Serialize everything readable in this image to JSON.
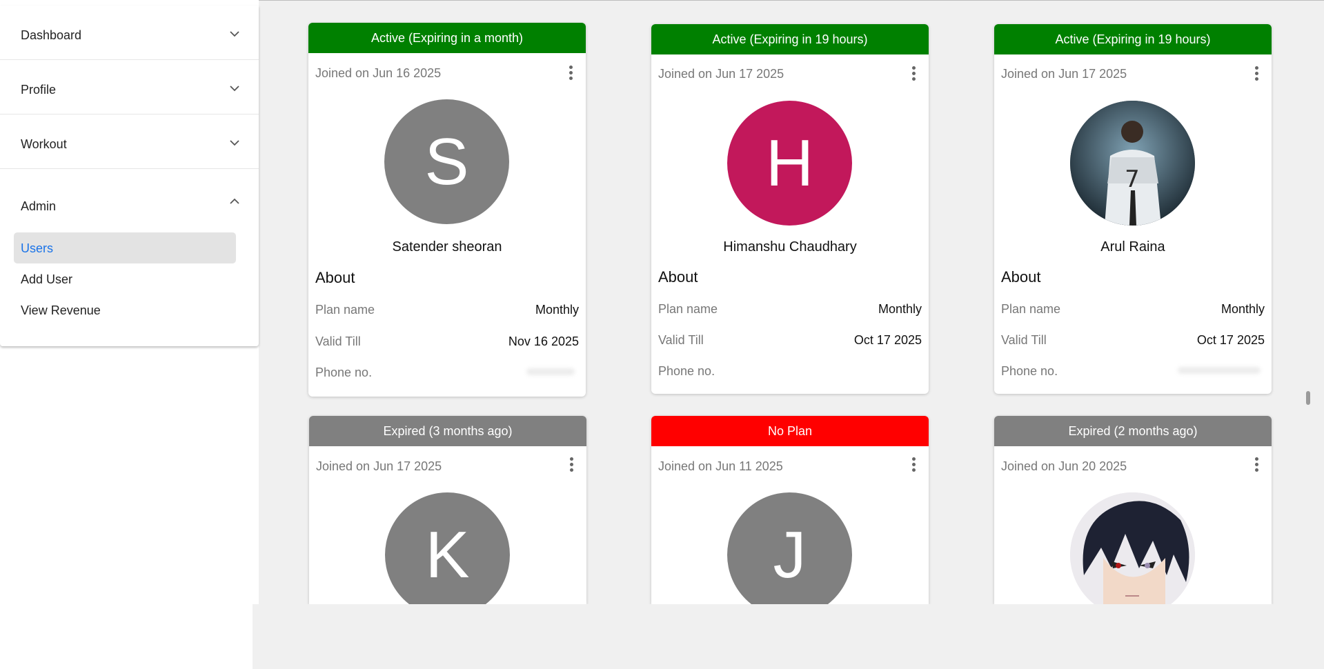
{
  "sidebar": {
    "sections": [
      {
        "label": "Dashboard"
      },
      {
        "label": "Profile"
      },
      {
        "label": "Workout"
      }
    ],
    "admin": {
      "label": "Admin",
      "items": [
        {
          "label": "Users",
          "active": true
        },
        {
          "label": "Add User"
        },
        {
          "label": "View Revenue"
        }
      ]
    }
  },
  "about_label": "About",
  "field_labels": {
    "plan": "Plan name",
    "valid": "Valid Till",
    "phone": "Phone no."
  },
  "colors": {
    "active": "#008000",
    "expired": "#808080",
    "no_plan": "#ff0000",
    "avatar_grey": "#808080",
    "avatar_pink": "#c2185b",
    "link_blue": "#1a73e8"
  },
  "cards": [
    {
      "status": "Active (Expiring in a month)",
      "status_type": "active",
      "joined": "Joined on Jun 16 2025",
      "avatar_letter": "S",
      "avatar_color": "#808080",
      "name": "Satender sheoran",
      "plan": "Monthly",
      "valid_till": "Nov 16 2025"
    },
    {
      "status": "Active (Expiring in 19 hours)",
      "status_type": "active",
      "joined": "Joined on Jun 17 2025",
      "avatar_letter": "H",
      "avatar_color": "#c2185b",
      "name": "Himanshu Chaudhary",
      "plan": "Monthly",
      "valid_till": "Oct 17 2025"
    },
    {
      "status": "Active (Expiring in 19 hours)",
      "status_type": "active",
      "joined": "Joined on Jun 17 2025",
      "avatar_image": "football-player-photo",
      "name": "Arul Raina",
      "plan": "Monthly",
      "valid_till": "Oct 17 2025"
    },
    {
      "status": "Expired (3 months ago)",
      "status_type": "expired",
      "joined": "Joined on Jun 17 2025",
      "avatar_letter": "K",
      "avatar_color": "#808080"
    },
    {
      "status": "No Plan",
      "status_type": "no_plan",
      "joined": "Joined on Jun 11 2025",
      "avatar_letter": "J",
      "avatar_color": "#808080"
    },
    {
      "status": "Expired (2 months ago)",
      "status_type": "expired",
      "joined": "Joined on Jun 20 2025",
      "avatar_image": "anime-character-portrait"
    }
  ]
}
